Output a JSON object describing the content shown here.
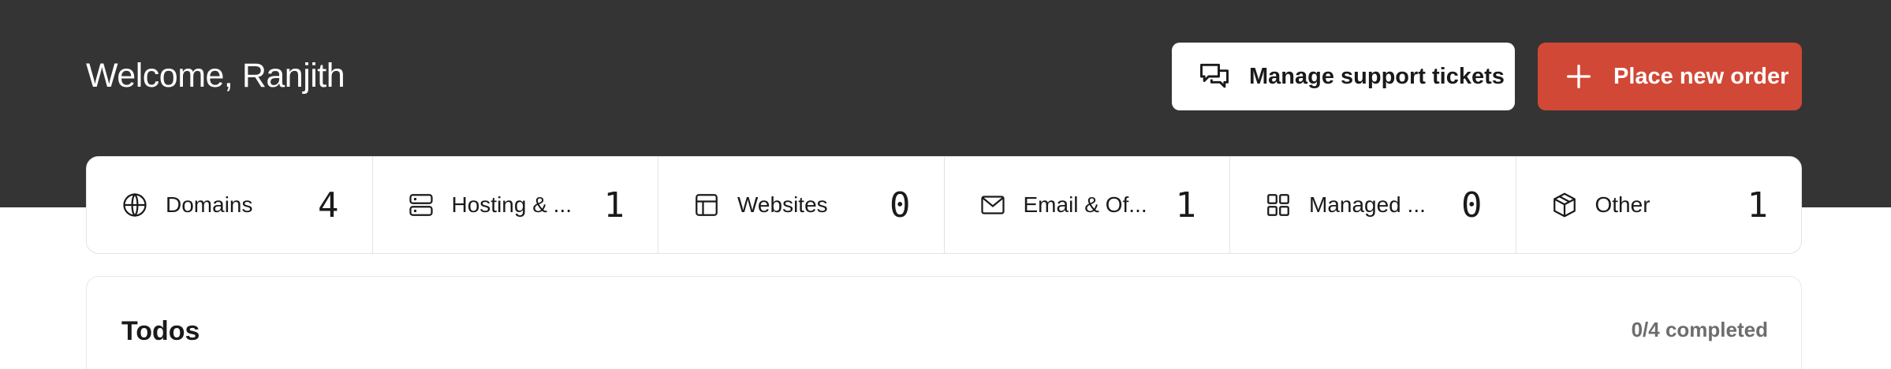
{
  "header": {
    "welcome": "Welcome, Ranjith",
    "support_button_label": "Manage support tickets",
    "support_button_icon": "chat-bubbles-icon",
    "order_button_label": "Place new order",
    "order_button_icon": "plus-icon"
  },
  "stats": [
    {
      "label": "Domains",
      "count": "4",
      "icon": "globe-icon"
    },
    {
      "label": "Hosting & ...",
      "count": "1",
      "icon": "server-icon"
    },
    {
      "label": "Websites",
      "count": "0",
      "icon": "layout-icon"
    },
    {
      "label": "Email & Of...",
      "count": "1",
      "icon": "envelope-icon"
    },
    {
      "label": "Managed ...",
      "count": "0",
      "icon": "grid-icon"
    },
    {
      "label": "Other",
      "count": "1",
      "icon": "box-icon"
    }
  ],
  "todos": {
    "title": "Todos",
    "progress": "0/4 completed"
  },
  "colors": {
    "hero_background": "#343434",
    "accent": "#d14836",
    "card_border": "#e3e3e3"
  }
}
